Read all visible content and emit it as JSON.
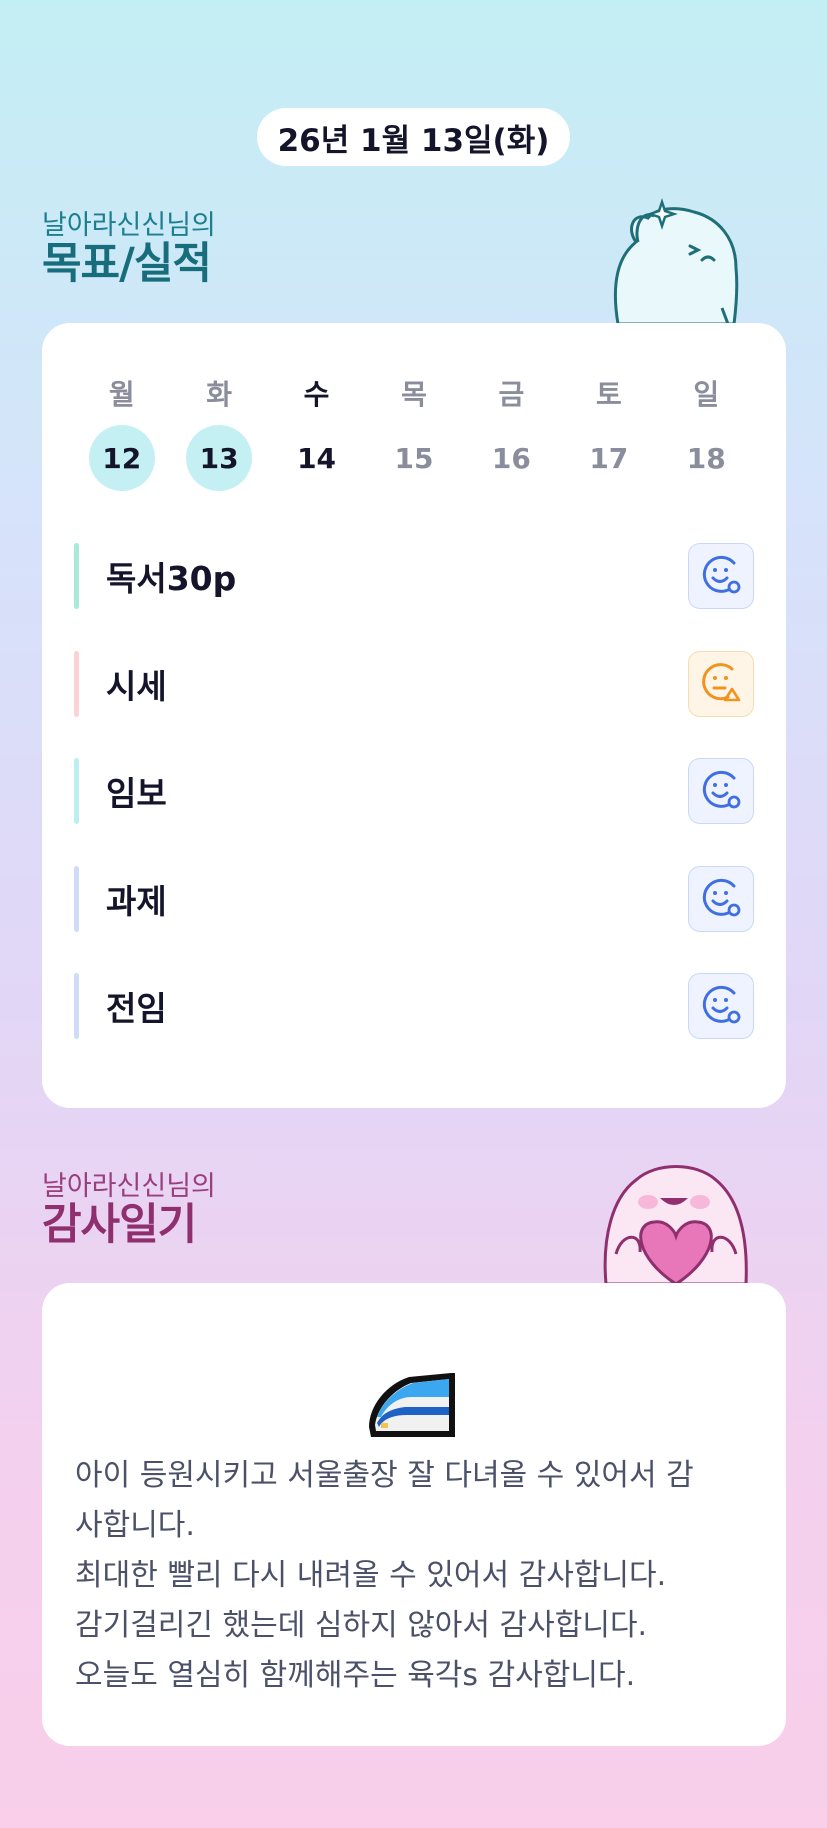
{
  "date_label": "26년 1월 13일(화)",
  "goal_section": {
    "subtitle": "날아라신신님의",
    "title": "목표/실적"
  },
  "week": [
    {
      "name": "월",
      "num": "12",
      "state": "done"
    },
    {
      "name": "화",
      "num": "13",
      "state": "done"
    },
    {
      "name": "수",
      "num": "14",
      "state": "today"
    },
    {
      "name": "목",
      "num": "15",
      "state": "future"
    },
    {
      "name": "금",
      "num": "16",
      "state": "future"
    },
    {
      "name": "토",
      "num": "17",
      "state": "future"
    },
    {
      "name": "일",
      "num": "18",
      "state": "future"
    }
  ],
  "goals": [
    {
      "label": "독서30p",
      "bar_color": "#a8ead6",
      "status": "good",
      "status_icon": "smile-check-icon"
    },
    {
      "label": "시세",
      "bar_color": "#fbd3d6",
      "status": "warn",
      "status_icon": "neutral-triangle-icon"
    },
    {
      "label": "임보",
      "bar_color": "#bdeef2",
      "status": "good",
      "status_icon": "smile-check-icon"
    },
    {
      "label": "과제",
      "bar_color": "#cfdcf8",
      "status": "good",
      "status_icon": "smile-check-icon"
    },
    {
      "label": "전임",
      "bar_color": "#cfdcf8",
      "status": "good",
      "status_icon": "smile-check-icon"
    }
  ],
  "gratitude_section": {
    "subtitle": "날아라신신님의",
    "title": "감사일기",
    "icon": "train-icon",
    "text": "아이 등원시키고 서울출장 잘 다녀올 수 있어서 감\n사합니다.\n최대한 빨리 다시 내려올 수 있어서 감사합니다.\n감기걸리긴 했는데 심하지 않아서 감사합니다.\n오늘도 열심히 함께해주는 육각s 감사합니다."
  },
  "colors": {
    "accent_good": "#3f6fe0",
    "accent_warn": "#f0941f",
    "goal_title": "#176d7c",
    "gratitude_title": "#8f2f6e"
  }
}
